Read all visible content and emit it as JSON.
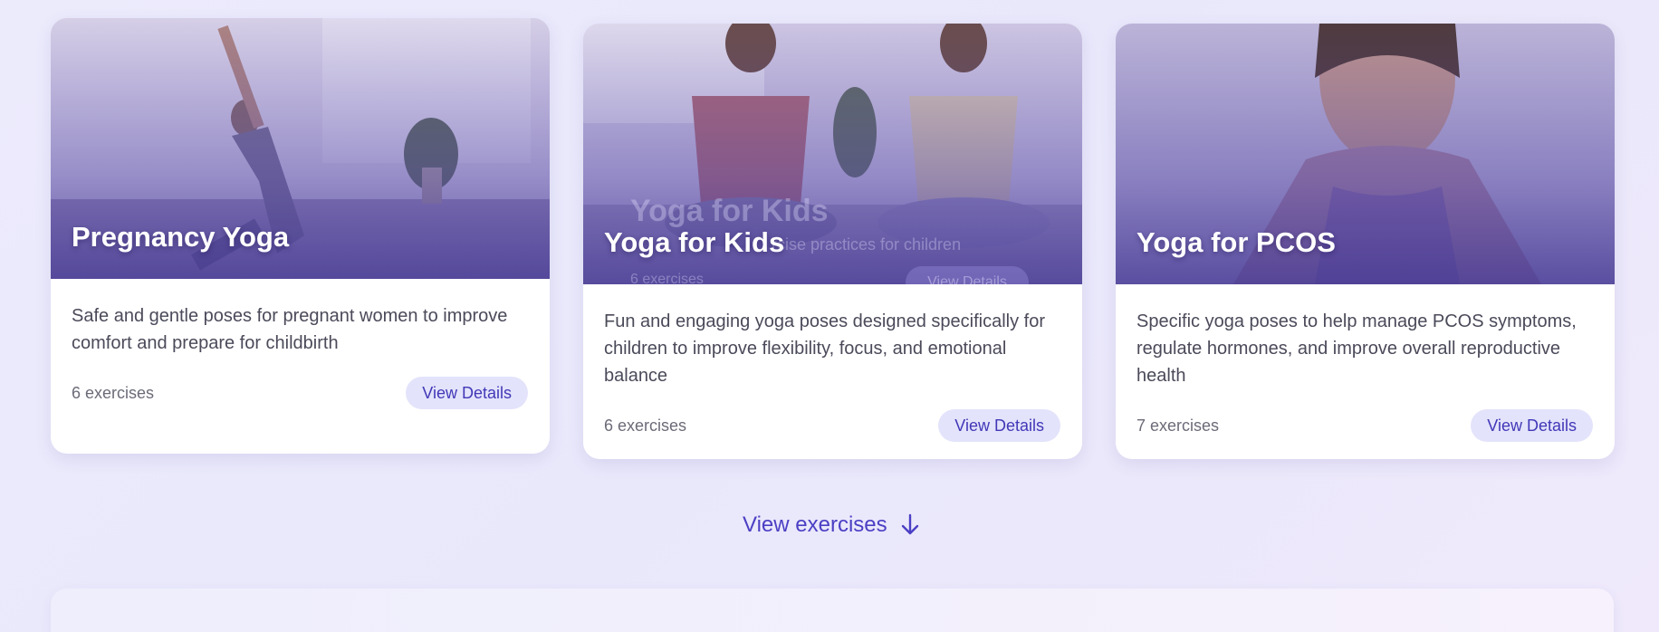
{
  "cards": [
    {
      "title": "Pregnancy Yoga",
      "description": "Safe and gentle poses for pregnant women to improve comfort and prepare for childbirth",
      "count": "6 exercises",
      "button": "View Details"
    },
    {
      "title": "Yoga for Kids",
      "description": "Fun and engaging yoga poses designed specifically for children to improve flexibility, focus, and emotional balance",
      "count": "6 exercises",
      "button": "View Details",
      "ghost": {
        "title": "Yoga for Kids",
        "subtitle": "rcise practices for children",
        "count": "6 exercises",
        "button": "View Details"
      }
    },
    {
      "title": "Yoga for PCOS",
      "description": "Specific yoga poses to help manage PCOS symptoms, regulate hormones, and improve overall reproductive health",
      "count": "7 exercises",
      "button": "View Details"
    }
  ],
  "view_exercises": {
    "label": "View exercises",
    "icon": "arrow-down-icon"
  },
  "colors": {
    "accent": "#4b3fc4",
    "button_bg": "#e3e3fb",
    "overlay": "#564aaa"
  }
}
